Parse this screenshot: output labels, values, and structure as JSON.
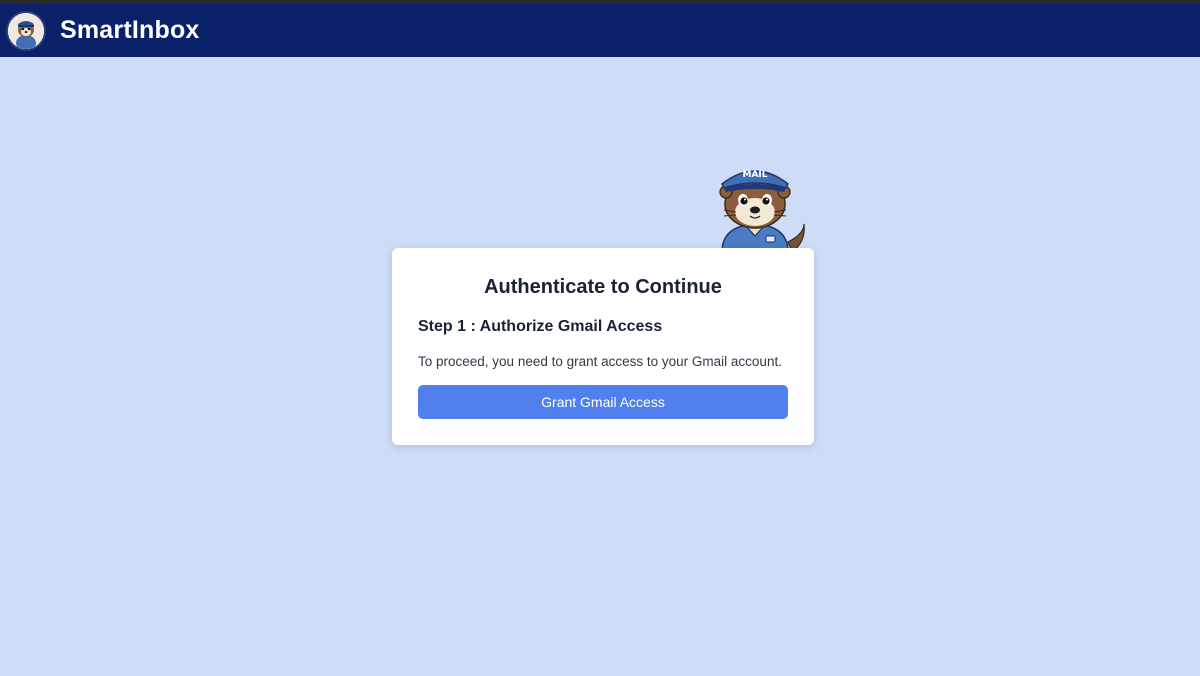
{
  "header": {
    "brand": "SmartInbox",
    "logo_icon": "otter-mailman-avatar-icon",
    "bg_color": "#0a2169"
  },
  "mascot": {
    "icon": "otter-mailman-mascot-icon",
    "cap_text": "MAIL"
  },
  "auth_card": {
    "title": "Authenticate to Continue",
    "step_title": "Step 1 : Authorize Gmail Access",
    "description": "To proceed, you need to grant access to your Gmail account.",
    "button_label": "Grant Gmail Access",
    "button_color": "#4f80ed"
  },
  "page": {
    "background_color": "#cfdcf7"
  }
}
